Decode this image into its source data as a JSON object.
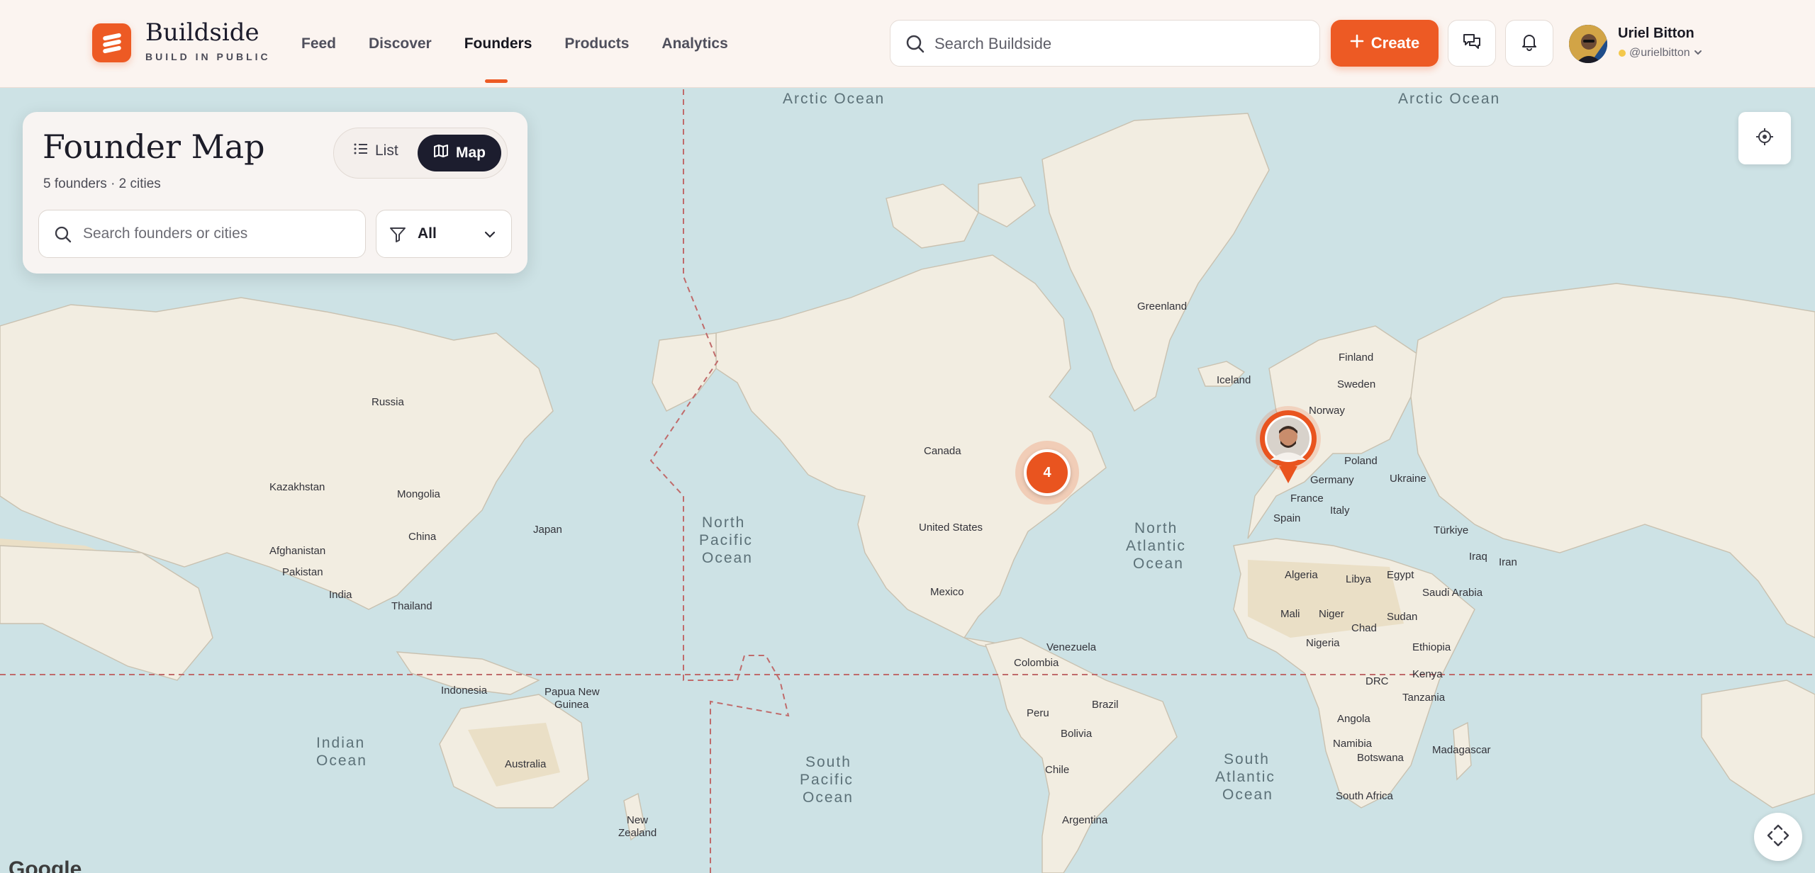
{
  "brand": {
    "name": "Buildside",
    "tagline": "BUILD IN PUBLIC",
    "accent": "#ed5a24"
  },
  "nav": {
    "items": [
      {
        "label": "Feed"
      },
      {
        "label": "Discover"
      },
      {
        "label": "Founders",
        "active": true
      },
      {
        "label": "Products"
      },
      {
        "label": "Analytics"
      }
    ]
  },
  "search": {
    "placeholder": "Search Buildside"
  },
  "create": {
    "label": "Create"
  },
  "user": {
    "name": "Uriel Bitton",
    "handle": "@urielbitton"
  },
  "panel": {
    "title": "Founder Map",
    "subtitle": "5 founders · 2 cities",
    "view_list": "List",
    "view_map": "Map",
    "search_placeholder": "Search founders or cities",
    "filter_value": "All"
  },
  "map": {
    "cluster_count": "4",
    "attribution": "Google",
    "ocean_labels": {
      "arctic_1": "Arctic Ocean",
      "arctic_2": "Arctic Ocean",
      "north_pacific_1": "North",
      "north_pacific_2": "Pacific",
      "north_pacific_3": "Ocean",
      "north_atlantic_1": "North",
      "north_atlantic_2": "Atlantic",
      "north_atlantic_3": "Ocean",
      "south_pacific_1": "South",
      "south_pacific_2": "Pacific",
      "south_pacific_3": "Ocean",
      "south_atlantic_1": "South",
      "south_atlantic_2": "Atlantic",
      "south_atlantic_3": "Ocean",
      "indian_1": "Indian",
      "indian_2": "Ocean"
    },
    "countries": {
      "greenland": "Greenland",
      "iceland": "Iceland",
      "finland": "Finland",
      "sweden": "Sweden",
      "norway": "Norway",
      "russia": "Russia",
      "canada": "Canada",
      "united_states": "United States",
      "mexico": "Mexico",
      "kazakhstan": "Kazakhstan",
      "mongolia": "Mongolia",
      "china": "China",
      "japan": "Japan",
      "afghanistan": "Afghanistan",
      "pakistan": "Pakistan",
      "india": "India",
      "thailand": "Thailand",
      "indonesia": "Indonesia",
      "papua_1": "Papua New",
      "papua_2": "Guinea",
      "australia": "Australia",
      "new_zealand_1": "New",
      "new_zealand_2": "Zealand",
      "poland": "Poland",
      "germany": "Germany",
      "ukraine": "Ukraine",
      "france": "France",
      "italy": "Italy",
      "spain": "Spain",
      "turkiye": "Türkiye",
      "iraq": "Iraq",
      "iran": "Iran",
      "algeria": "Algeria",
      "libya": "Libya",
      "egypt": "Egypt",
      "saudi_arabia": "Saudi Arabia",
      "mali": "Mali",
      "niger": "Niger",
      "chad": "Chad",
      "sudan": "Sudan",
      "nigeria": "Nigeria",
      "ethiopia": "Ethiopia",
      "kenya": "Kenya",
      "drc": "DRC",
      "tanzania": "Tanzania",
      "angola": "Angola",
      "namibia": "Namibia",
      "botswana": "Botswana",
      "madagascar": "Madagascar",
      "south_africa": "South Africa",
      "venezuela": "Venezuela",
      "colombia": "Colombia",
      "brazil": "Brazil",
      "peru": "Peru",
      "bolivia": "Bolivia",
      "chile": "Chile",
      "argentina": "Argentina"
    }
  }
}
